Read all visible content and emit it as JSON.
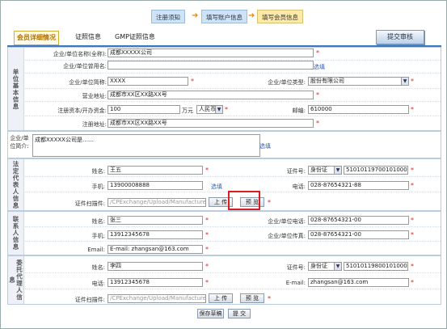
{
  "steps": [
    {
      "label": "注册须知",
      "style": "blue"
    },
    {
      "label": "填写账户信息",
      "style": "blue"
    },
    {
      "label": "填写会员信息",
      "style": "yellow"
    }
  ],
  "tabs": [
    {
      "label": "会员详细情况",
      "active": true
    },
    {
      "label": "证照信息",
      "active": false
    },
    {
      "label": "GMP证照信息",
      "active": false
    }
  ],
  "submit_label": "提交审核",
  "company": {
    "heading": "单位基本信息",
    "name_label": "企业/单位名称(全称):",
    "name_value": "成都XXXXX公司",
    "former_label": "企业/单位曾用名:",
    "former_value": "",
    "former_link": "选填",
    "short_label": "企业/单位简称:",
    "short_value": "XXXX",
    "type_label": "企业/单位类型:",
    "type_value": "股份有限公司",
    "biz_addr_label": "营业地址:",
    "biz_addr_value": "成都市XX区XX路XX号",
    "capital_label": "注册资本/开办资金:",
    "capital_value": "100",
    "capital_unit": "万元",
    "currency_value": "人民币",
    "zip_label": "邮编:",
    "zip_value": "610000",
    "reg_addr_label": "注册地址:",
    "reg_addr_value": "成都市XX区XX路XX号"
  },
  "intro": {
    "heading": "企业/单位简介:",
    "value": "成都XXXXX公司是……",
    "link": "选填"
  },
  "legal": {
    "heading": "法定代表人信息",
    "name_label": "姓名:",
    "name_value": "王五",
    "id_label": "证件号:",
    "id_type": "身份证",
    "id_value": "510101197001010001",
    "mobile_label": "手机:",
    "mobile_value": "13900008888",
    "mobile_link": "选填",
    "phone_label": "电话:",
    "phone_value": "028-87654321-88",
    "scan_label": "证件扫描件:",
    "scan_value": "/CPExchange/Upload/Manufacture",
    "upload_label": "上 传",
    "browse_label": "预 览"
  },
  "contact": {
    "heading": "联系人信息",
    "name_label": "姓名:",
    "name_value": "张三",
    "tel_label": "企业/单位电话:",
    "tel_value": "028-87654321-00",
    "mobile_label": "手机:",
    "mobile_value": "13912345678",
    "fax_label": "企业/单位传真:",
    "fax_value": "028-87654321-00",
    "email_label": "Email:",
    "email_value": "E-mail: zhangsan@163.com"
  },
  "agent": {
    "heading": "委托代理人信息",
    "name_label": "姓名:",
    "name_value": "李四",
    "id_label": "证件号:",
    "id_type": "身份证",
    "id_value": "510101198001010001",
    "phone_label": "电话:",
    "phone_value": "13912345678",
    "email_label": "E-mail:",
    "email_value": "zhangsan@163.com",
    "scan_label": "证件扫描件:",
    "scan_value": "/CPExchange/Upload/Manufacture",
    "upload_label": "上 传",
    "browse_label": "预 览"
  },
  "footer": {
    "save_label": "保存草稿",
    "submit_label": "提 交"
  },
  "colors": {
    "accent": "#3a78c0",
    "highlight": "#d81f1f",
    "required": "#e02020",
    "link": "#2a5dbf"
  }
}
